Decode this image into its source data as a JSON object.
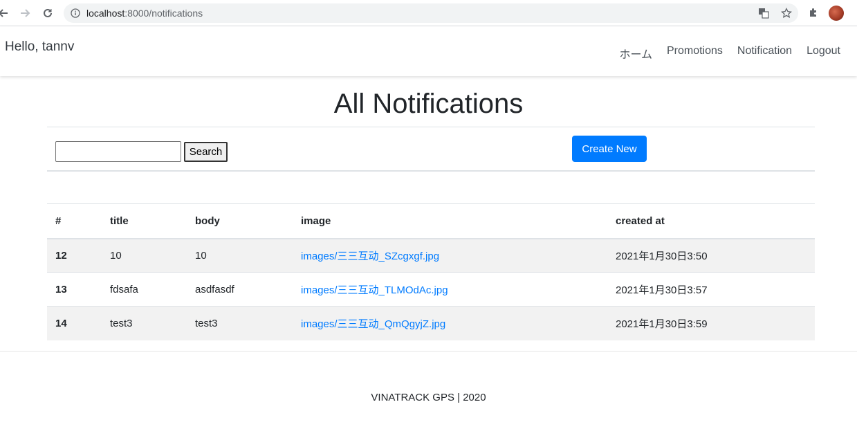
{
  "browser": {
    "url_host": "localhost",
    "url_path": ":8000/notifications"
  },
  "navbar": {
    "greeting": "Hello, tannv",
    "links": [
      "ホーム",
      "Promotions",
      "Notification",
      "Logout"
    ]
  },
  "main": {
    "title": "All Notifications",
    "search": {
      "value": "",
      "placeholder": "",
      "button_label": "Search"
    },
    "create_button_label": "Create New",
    "table": {
      "headers": [
        "#",
        "title",
        "body",
        "image",
        "created at"
      ],
      "rows": [
        {
          "id": "12",
          "title": "10",
          "body": "10",
          "image": "images/三三互动_SZcgxgf.jpg",
          "created_at": "2021年1月30日3:50"
        },
        {
          "id": "13",
          "title": "fdsafa",
          "body": "asdfasdf",
          "image": "images/三三互动_TLMOdAc.jpg",
          "created_at": "2021年1月30日3:57"
        },
        {
          "id": "14",
          "title": "test3",
          "body": "test3",
          "image": "images/三三互动_QmQgyjZ.jpg",
          "created_at": "2021年1月30日3:59"
        }
      ]
    }
  },
  "footer": {
    "text": "VINATRACK GPS | 2020"
  },
  "colors": {
    "primary": "#007bff",
    "stripe": "#f2f2f2",
    "border": "#dee2e6"
  }
}
